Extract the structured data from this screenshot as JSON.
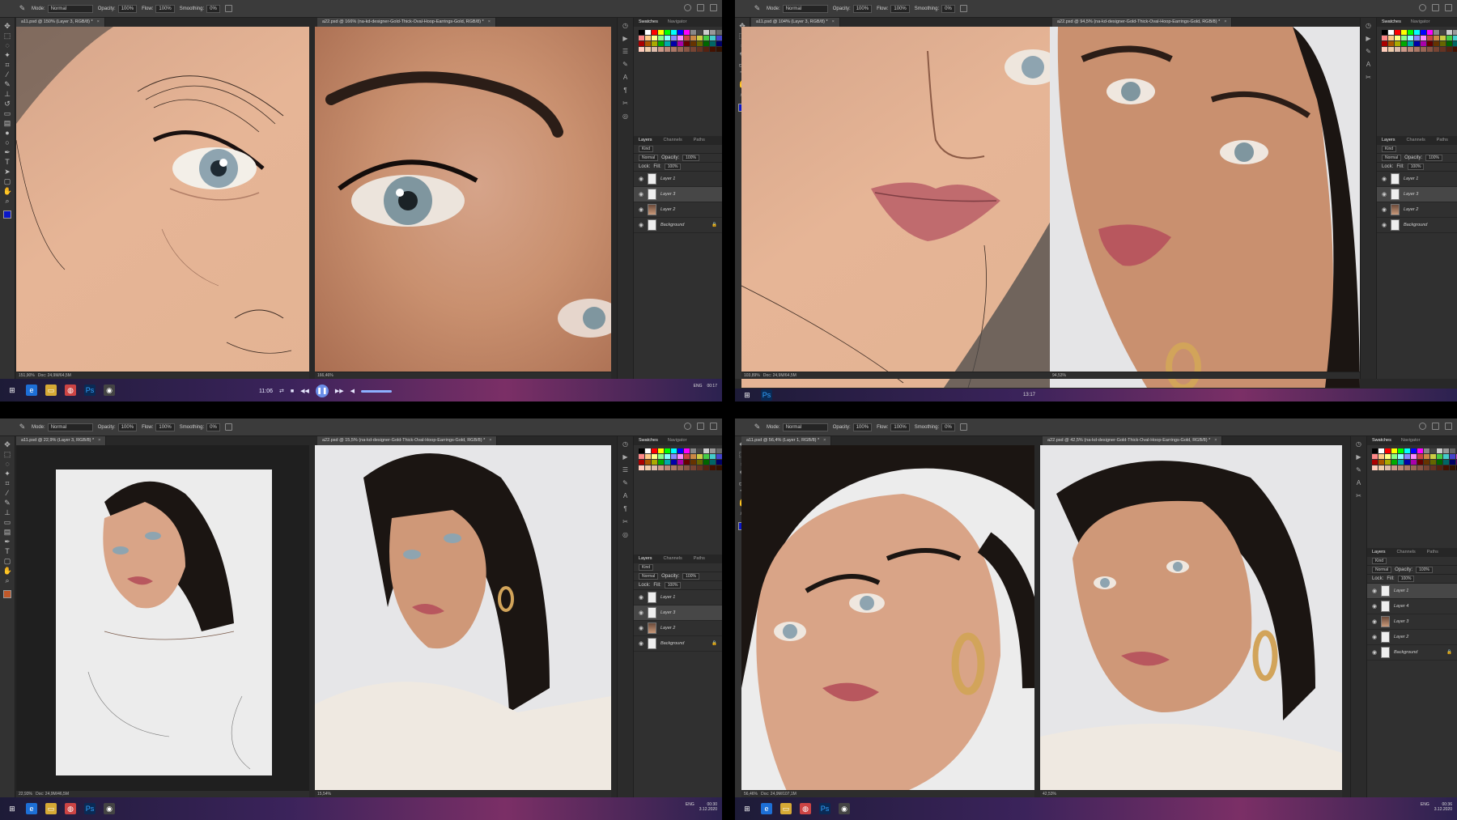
{
  "options": {
    "mode_label": "Mode:",
    "mode_value": "Normal",
    "opacity_label": "Opacity:",
    "opacity_value": "100%",
    "flow_label": "Flow:",
    "flow_value": "100%",
    "smoothing_label": "Smoothing:",
    "smoothing_value": "0%"
  },
  "quads": {
    "q1": {
      "tab_sketch": "a11.psd @ 150% (Layer 3, RGB/8) *",
      "tab_photo": "a22.psd @ 166% (na-kd-designer-Gold-Thick-Oval-Hoop-Earrings-Gold, RGB/8) *",
      "status_left": "151,90%",
      "status_doc": "Doc: 24,9M/64,5M",
      "status_right": "166,46%",
      "layers": [
        "Layer 1",
        "Layer 3",
        "Layer 2",
        "Background"
      ]
    },
    "q2": {
      "tab_sketch": "a11.psd @ 104% (Layer 3, RGB/8) *",
      "tab_photo": "a22.psd @ 94,5% (na-kd-designer-Gold-Thick-Oval-Hoop-Earrings-Gold, RGB/8) *",
      "status_left": "103,89%",
      "status_doc": "Doc: 24,9M/64,5M",
      "status_right": "94,53%",
      "layers": [
        "Layer 1",
        "Layer 3",
        "Layer 2",
        "Background"
      ]
    },
    "q3": {
      "tab_sketch": "a11.psd @ 22,9% (Layer 3, RGB/8) *",
      "tab_photo": "a22.psd @ 15,5% (na-kd-designer-Gold-Thick-Oval-Hoop-Earrings-Gold, RGB/8) *",
      "status_left": "22,93%",
      "status_doc": "Doc: 24,9M/46,5M",
      "status_right": "15,54%",
      "layers": [
        "Layer 1",
        "Layer 3",
        "Layer 2",
        "Background"
      ]
    },
    "q4": {
      "tab_sketch": "a11.psd @ 56,4% (Layer 1, RGB/8) *",
      "tab_photo": "a22.psd @ 42,5% (na-kd-designer-Gold-Thick-Oval-Hoop-Earrings-Gold, RGB/8) *",
      "status_left": "56,46%",
      "status_doc": "Doc: 24,9M/107,1M",
      "status_right": "42,53%",
      "layers": [
        "Layer 1",
        "Layer 4",
        "Layer 3",
        "Layer 2",
        "Background"
      ]
    }
  },
  "panels": {
    "swatches_tab": "Swatches",
    "navigator_tab": "Navigator",
    "layers_tab": "Layers",
    "channels_tab": "Channels",
    "paths_tab": "Paths",
    "kind_label": "Kind",
    "blend_mode": "Normal",
    "opacity_label": "Opacity:",
    "opacity_value": "100%",
    "lock_label": "Lock:",
    "fill_label": "Fill:",
    "fill_value": "100%"
  },
  "player": {
    "time": "11:06"
  },
  "taskbar": {
    "ps_label": "Ps",
    "lang": "ENG",
    "clock_q1": "00:17",
    "clock_q3_time": "00:30",
    "clock_q3_date": "3.12.2020",
    "clock_q4_time": "00:36",
    "clock_q4_date": "3.12.2020",
    "q2_time": "13:17"
  },
  "colors": {
    "ps_dark": "#282828",
    "ps_panel": "#303030",
    "skin": "#e3b393",
    "lips": "#b8575e",
    "iris": "#8ea4b0",
    "hair": "#1b1512",
    "player_blue": "#6a8ee8"
  }
}
